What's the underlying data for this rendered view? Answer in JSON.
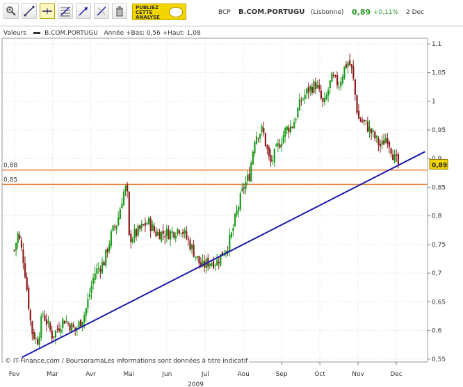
{
  "toolbar": {
    "tools": [
      "zoom-icon",
      "draw-line-icon",
      "horizontal-line-icon",
      "fibonacci-icon",
      "trend-arrow-icon",
      "cross-line-icon",
      "trash-icon"
    ],
    "publiez_lines": [
      "PUBLIEZ",
      "CETTE",
      "ANALYSE"
    ]
  },
  "header": {
    "ticker": "BCP",
    "name": "B.COM.PORTUGU",
    "market": "(Lisbonne)",
    "last": "0,89",
    "change": "+0,11%",
    "date": "2 Dec"
  },
  "legend": {
    "label": "Valeurs",
    "series": "B.COM.PORTUGU",
    "range_text": "Année +Bas: 0,56 +Haut: 1,08"
  },
  "copyright": "© IT-Finance.com / BoursoramaLes informations sont données à titre indicatif",
  "colors": {
    "up_candle": "#1a9a1a",
    "down_candle": "#8b1a1a",
    "trendline": "#1a1aa8",
    "horizontal_lines": "#e8823a",
    "last_price_box": "#f2d600",
    "change_green": "#2a9a2a"
  },
  "chart_data": {
    "type": "candlestick",
    "x_tick_labels": [
      "Fev",
      "Mar",
      "Avr",
      "Mai",
      "Jun",
      "Jul",
      "Aou",
      "Sep",
      "Oct",
      "Nov",
      "Dec"
    ],
    "x_axis_year": "2009",
    "y_tick_labels": [
      "0,55",
      "0,6",
      "0,65",
      "0,7",
      "0,75",
      "0,8",
      "0,85",
      "0,9",
      "0,95",
      "1",
      "1,05",
      "1,1"
    ],
    "ylim": [
      0.545,
      1.11
    ],
    "close_path_months": [
      0,
      0.1,
      0.25,
      0.45,
      0.6,
      0.75,
      1,
      1.3,
      1.6,
      1.85,
      2.1,
      2.35,
      2.55,
      2.7,
      2.85,
      2.95,
      3.0,
      3.2,
      3.5,
      3.7,
      3.9,
      4.1,
      4.35,
      4.6,
      4.9,
      5.1,
      5.3,
      5.4,
      5.5,
      5.6,
      5.7,
      5.8,
      6.0,
      6.15,
      6.3,
      6.5,
      6.7,
      6.9,
      7.1,
      7.3,
      7.5,
      7.7,
      7.9,
      8.1,
      8.3,
      8.5,
      8.65,
      8.75,
      8.85,
      9.0,
      9.2,
      9.4,
      9.6,
      9.75,
      9.95,
      10.05
    ],
    "close_path_values": [
      0.74,
      0.77,
      0.72,
      0.6,
      0.58,
      0.63,
      0.59,
      0.62,
      0.6,
      0.63,
      0.7,
      0.72,
      0.77,
      0.79,
      0.84,
      0.85,
      0.76,
      0.77,
      0.79,
      0.77,
      0.77,
      0.77,
      0.78,
      0.75,
      0.71,
      0.72,
      0.72,
      0.73,
      0.74,
      0.75,
      0.77,
      0.8,
      0.85,
      0.87,
      0.94,
      0.95,
      0.89,
      0.92,
      0.95,
      0.96,
      1.0,
      1.02,
      1.03,
      0.99,
      1.04,
      1.03,
      1.06,
      1.07,
      1.05,
      0.97,
      0.96,
      0.94,
      0.92,
      0.94,
      0.9,
      0.89
    ],
    "year_low": 0.56,
    "year_high": 1.08,
    "last_value": 0.89,
    "last_value_label": "0,89",
    "horizontal_levels": [
      {
        "value": 0.88,
        "label": "0,88"
      },
      {
        "value": 0.855,
        "label": "0,85"
      }
    ],
    "trendline": {
      "from": {
        "month": 0.2,
        "value": 0.553
      },
      "to": {
        "month": 10.75,
        "value": 0.912
      }
    }
  }
}
